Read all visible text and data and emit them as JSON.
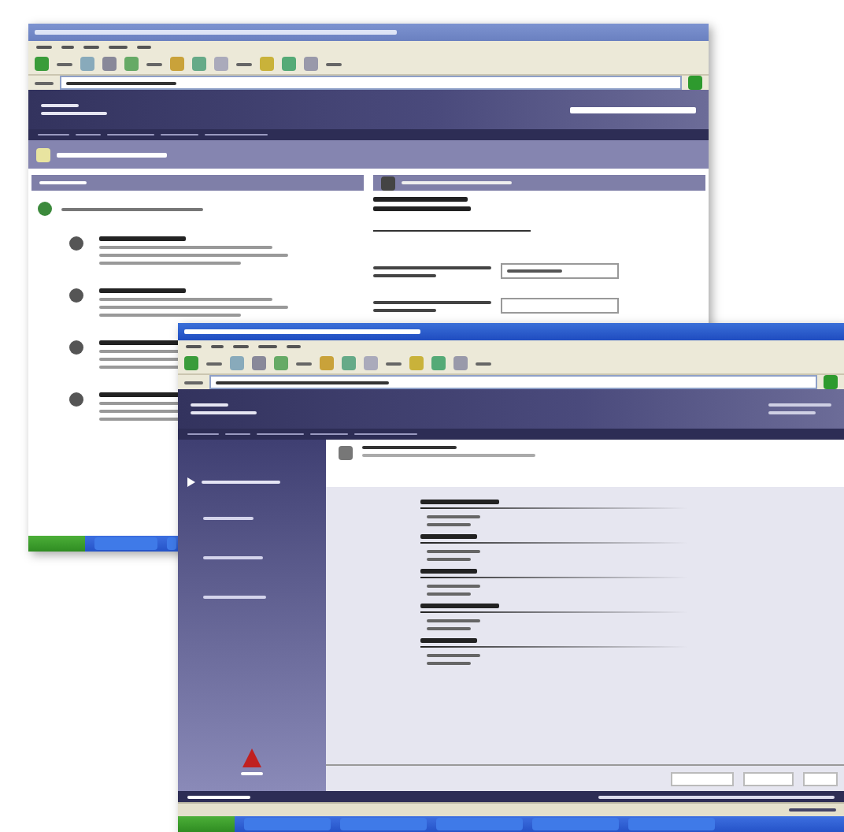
{
  "windows": [
    {
      "kind": "portal",
      "selected": false
    },
    {
      "kind": "settings",
      "selected": true
    }
  ]
}
